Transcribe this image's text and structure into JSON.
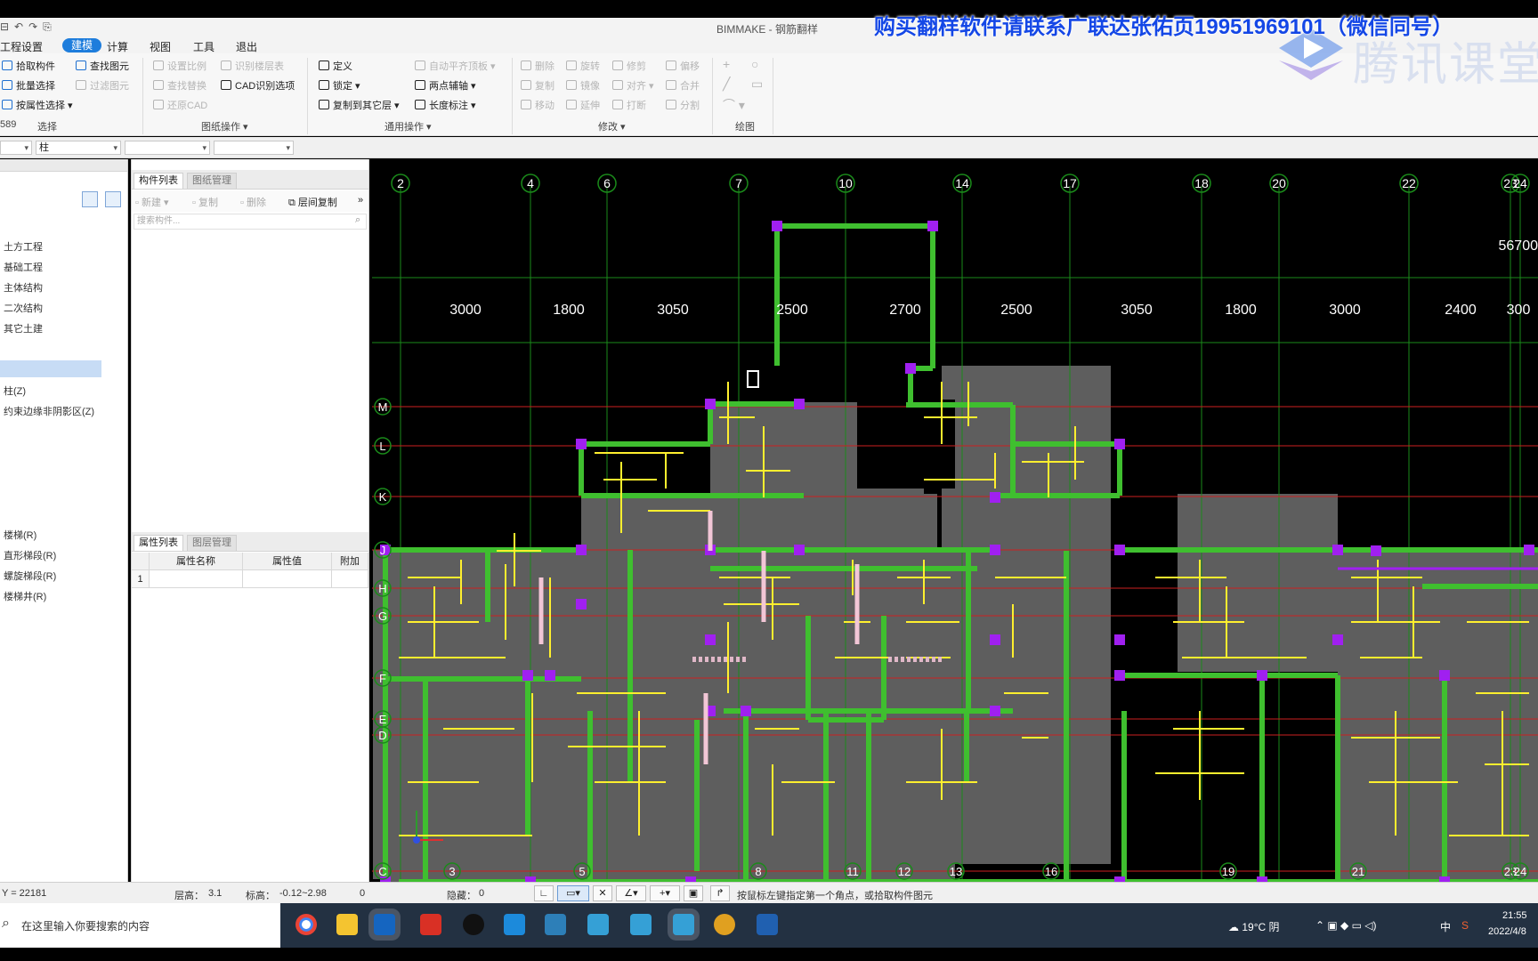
{
  "titlebar": {
    "app_title": "BIMMAKE - 钢筋翻样",
    "promo": "购买翻样软件请联系广联达张佑页19951969101（微信同号）",
    "watermark": "腾讯课堂"
  },
  "menu": {
    "items": [
      "工程设置",
      "建模",
      "计算",
      "视图",
      "工具",
      "退出"
    ],
    "active_index": 1
  },
  "ribbon": {
    "select": {
      "items": [
        "拾取构件",
        "批量选择",
        "按属性选择",
        "查找图元",
        "过滤图元"
      ],
      "group_label": "选择",
      "edge_text": "589"
    },
    "drawing_ops": {
      "items": [
        "设置比例",
        "识别楼层表",
        "CAD识别选项",
        "查找替换",
        "还原CAD"
      ],
      "group_label": "图纸操作"
    },
    "general_ops": {
      "items": [
        "定义",
        "锁定",
        "复制到其它层",
        "自动平齐顶板",
        "两点辅轴",
        "长度标注"
      ],
      "group_label": "通用操作"
    },
    "modify": {
      "items": [
        "删除",
        "旋转",
        "修剪",
        "偏移",
        "复制",
        "镜像",
        "对齐",
        "合并",
        "移动",
        "延伸",
        "打断",
        "分割"
      ],
      "group_label": "修改"
    },
    "draw": {
      "group_label": "绘图"
    }
  },
  "selector": {
    "floor_value": "",
    "component_type": "柱",
    "field3": "",
    "field4": ""
  },
  "left_tree": {
    "categories": [
      "土方工程",
      "基础工程",
      "主体结构",
      "二次结构",
      "其它土建"
    ],
    "column_items": [
      "柱(Z)",
      "约束边缘非阴影区(Z)"
    ],
    "stair_items": [
      "楼梯(R)",
      "直形梯段(R)",
      "螺旋梯段(R)",
      "楼梯井(R)"
    ]
  },
  "component_panel": {
    "tabs": [
      "构件列表",
      "图纸管理"
    ],
    "toolbar": [
      "新建",
      "复制",
      "删除",
      "层间复制"
    ],
    "search_placeholder": "搜索构件..."
  },
  "property_panel": {
    "tabs": [
      "属性列表",
      "图层管理"
    ],
    "headers": [
      "属性名称",
      "属性值",
      "附加"
    ],
    "rows": [
      [
        "1",
        "",
        "",
        ""
      ]
    ]
  },
  "canvas": {
    "top_axes": [
      "2",
      "4",
      "6",
      "7",
      "10",
      "14",
      "17",
      "18",
      "20",
      "22",
      "23",
      "24"
    ],
    "bottom_axes": [
      "3",
      "5",
      "8",
      "11",
      "12",
      "13",
      "16",
      "19",
      "21",
      "23",
      "24"
    ],
    "row_axes": [
      "M",
      "L",
      "K",
      "J",
      "H",
      "G",
      "F",
      "E",
      "D",
      "C"
    ],
    "dimensions": [
      "3000",
      "1800",
      "3050",
      "2500",
      "2700",
      "2500",
      "3050",
      "1800",
      "3000",
      "2400",
      "300"
    ],
    "total_dimension": "56700",
    "colors": {
      "background": "#000000",
      "wall": "#3fbf2f",
      "column": "#a020f0",
      "rebar": "#ffef2e",
      "slab": "#5e5e5e",
      "axis_v": "#1a8a1a",
      "axis_h": "#cc2020"
    }
  },
  "status": {
    "coord": "Y = 22181",
    "floor_height_label": "层高：",
    "floor_height": "3.1",
    "elevation_label": "标高：",
    "elevation": "-0.12~2.98",
    "extra_value": "0",
    "hidden_label": "隐藏：",
    "hidden_value": "0",
    "hint": "按鼠标左键指定第一个角点，或拾取构件图元"
  },
  "taskbar": {
    "search_placeholder": "在这里输入你要搜索的内容",
    "weather": "19°C 阴",
    "ime": "中",
    "time": "21:55",
    "date": "2022/4/8"
  }
}
